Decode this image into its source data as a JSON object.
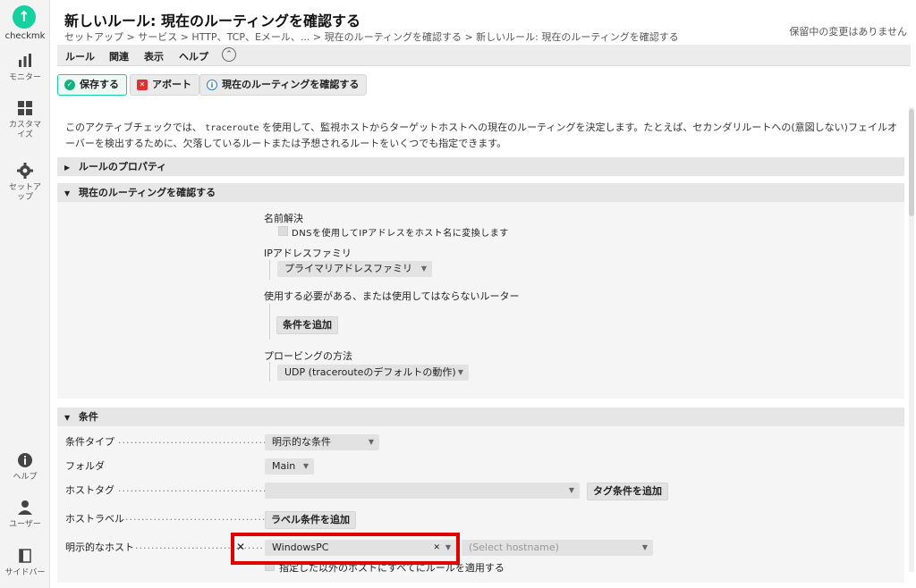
{
  "sidebar": {
    "logo_text": "checkmk",
    "items": [
      {
        "label": "モニター",
        "icon": "bar-chart-icon"
      },
      {
        "label": "カスタマイズ",
        "icon": "grid-icon"
      },
      {
        "label": "セットアップ",
        "icon": "gear-icon"
      },
      {
        "label": "ヘルプ",
        "icon": "info-icon"
      },
      {
        "label": "ユーザー",
        "icon": "user-icon"
      },
      {
        "label": "サイドバー",
        "icon": "sidebar-icon"
      }
    ]
  },
  "header": {
    "title": "新しいルール: 現在のルーティングを確認する",
    "breadcrumb": "セットアップ > サービス > HTTP、TCP、Eメール、... > 現在のルーティングを確認する > 新しいルール: 現在のルーティングを確認する",
    "pending_changes": "保留中の変更はありません"
  },
  "menubar": {
    "items": [
      "ルール",
      "関連",
      "表示",
      "ヘルプ"
    ],
    "toggle_icon": "chevron-up-icon"
  },
  "toolbar": {
    "save_label": "保存する",
    "abort_label": "アボート",
    "check_label": "現在のルーティングを確認する"
  },
  "description": {
    "before": "このアクティブチェックでは、",
    "code": "traceroute",
    "after": "を使用して、監視ホストからターゲットホストへの現在のルーティングを決定します。たとえば、セカンダリルートへの(意図しない)フェイルオーバーを検出するために、欠落しているルートまたは予想されるルートをいくつでも指定できます。"
  },
  "sections": {
    "properties": "ルールのプロパティ",
    "routing": "現在のルーティングを確認する",
    "conditions": "条件"
  },
  "routing": {
    "name_resolution_label": "名前解決",
    "dns_checkbox_label": "DNSを使用してIPアドレスをホスト名に変換します",
    "ip_family_label": "IPアドレスファミリ",
    "ip_family_value": "プライマリアドレスファミリ",
    "routers_label": "使用する必要がある、または使用してはならないルーター",
    "add_condition_label": "条件を追加",
    "probe_label": "プロービングの方法",
    "probe_value": "UDP (tracerouteのデフォルトの動作)"
  },
  "conditions": {
    "type_label": "条件タイプ",
    "type_value": "明示的な条件",
    "folder_label": "フォルダ",
    "folder_value": "Main",
    "host_tag_label": "ホストタグ",
    "add_tag_label": "タグ条件を追加",
    "host_label_label": "ホストラベル",
    "add_label_label": "ラベル条件を追加",
    "explicit_hosts_label": "明示的なホスト",
    "host_value": "WindowsPC",
    "host_placeholder": "(Select hostname)",
    "negate_label": "指定した以外のホストにすべてにルールを適用する"
  }
}
